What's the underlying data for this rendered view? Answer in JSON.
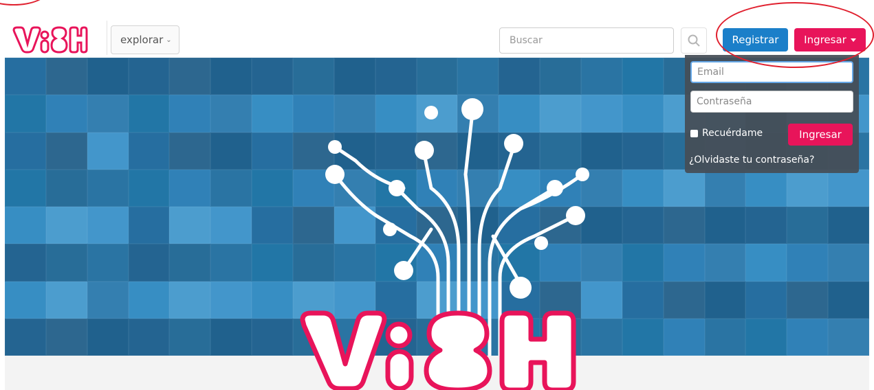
{
  "nav": {
    "logo_text": "ViSH",
    "explore_label": "explorar",
    "search_placeholder": "Buscar",
    "register_label": "Registrar",
    "login_label": "Ingresar"
  },
  "login_form": {
    "email_placeholder": "Email",
    "password_placeholder": "Contraseña",
    "remember_label": "Recuérdame",
    "submit_label": "Ingresar",
    "forgot_label": "¿Olvidaste tu contraseña?"
  },
  "hero": {
    "logo_text": "ViSH"
  },
  "colors": {
    "brand_pink": "#e8145a",
    "brand_blue": "#1b7fc9",
    "annotation_red": "#e0202e",
    "dropdown_bg": "#464e56"
  },
  "icons": [
    "chevron-down-icon",
    "search-icon",
    "caret-down-icon",
    "checkbox-icon"
  ]
}
